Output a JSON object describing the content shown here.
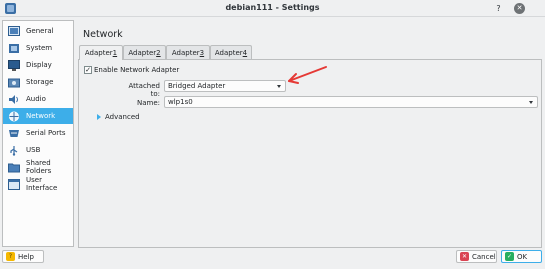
{
  "window": {
    "title": "debian111 - Settings",
    "help_glyph": "?",
    "close_glyph": "✕"
  },
  "sidebar": {
    "items": [
      {
        "label": "General",
        "icon": "general-icon"
      },
      {
        "label": "System",
        "icon": "system-icon"
      },
      {
        "label": "Display",
        "icon": "display-icon"
      },
      {
        "label": "Storage",
        "icon": "storage-icon"
      },
      {
        "label": "Audio",
        "icon": "audio-icon"
      },
      {
        "label": "Network",
        "icon": "network-icon",
        "active": true
      },
      {
        "label": "Serial Ports",
        "icon": "serial-ports-icon"
      },
      {
        "label": "USB",
        "icon": "usb-icon"
      },
      {
        "label": "Shared Folders",
        "icon": "shared-folders-icon"
      },
      {
        "label": "User Interface",
        "icon": "user-interface-icon"
      }
    ]
  },
  "main": {
    "title": "Network",
    "tabs": [
      {
        "prefix": "Adapter ",
        "num": "1",
        "active": true
      },
      {
        "prefix": "Adapter ",
        "num": "2"
      },
      {
        "prefix": "Adapter ",
        "num": "3"
      },
      {
        "prefix": "Adapter ",
        "num": "4"
      }
    ],
    "enable_label": "Enable Network Adapter",
    "enable_checked": true,
    "check_glyph": "✓",
    "attached_label": "Attached to:",
    "attached_value": "Bridged Adapter",
    "name_label": "Name:",
    "name_value": "wlp1s0",
    "advanced_label": "Advanced"
  },
  "footer": {
    "help_label": "Help",
    "cancel_label": "Cancel",
    "ok_label": "OK"
  },
  "colors": {
    "accent": "#3daee9",
    "annotation_arrow": "#e53935",
    "window_bg": "#eff0f1"
  }
}
